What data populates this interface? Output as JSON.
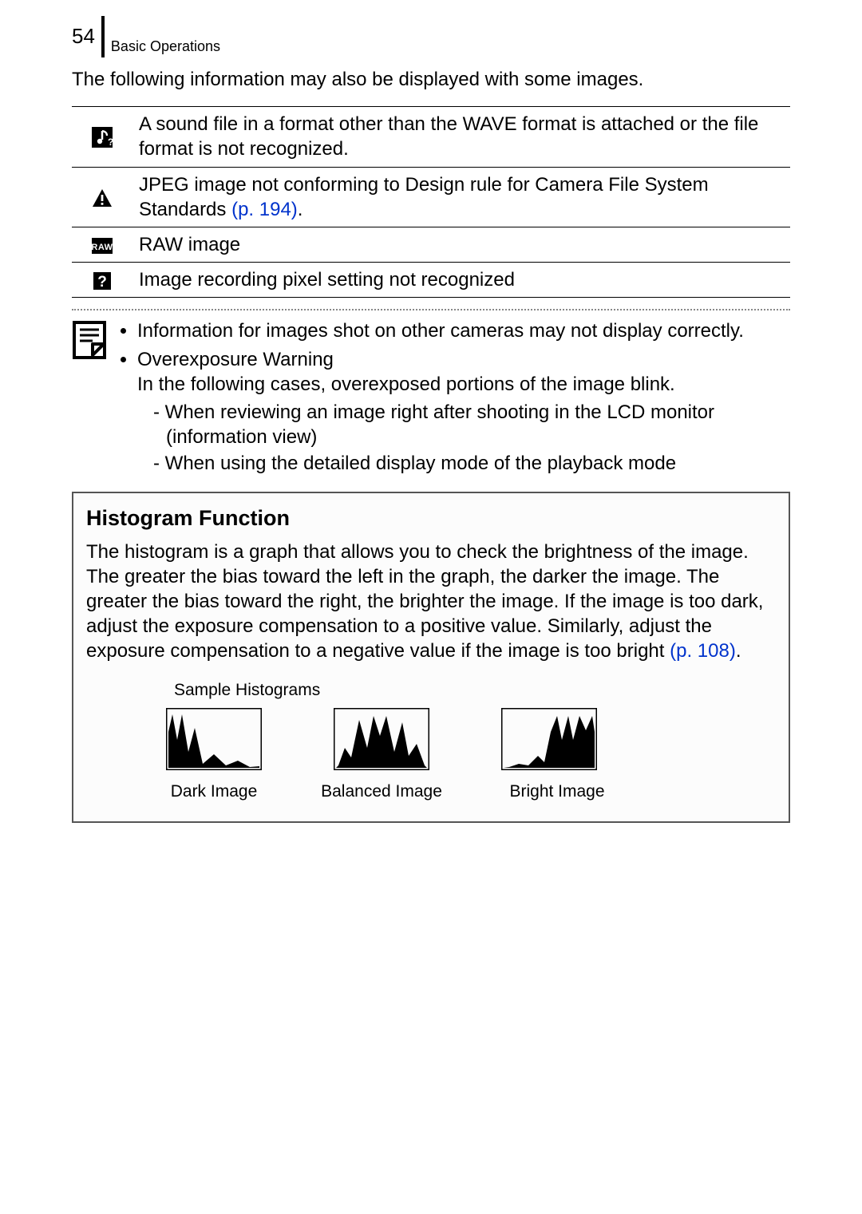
{
  "header": {
    "page_number": "54",
    "section": "Basic Operations"
  },
  "intro": "The following information may also be displayed with some images.",
  "table_rows": [
    {
      "icon": "music-question-icon",
      "desc": "A sound file in a format other than the WAVE format is attached or the file format is not recognized."
    },
    {
      "icon": "warning-triangle-icon",
      "desc": "JPEG image not conforming to Design rule for Camera File System Standards ",
      "page_ref": "(p. 194)",
      "desc_tail": "."
    },
    {
      "icon": "raw-icon",
      "desc": "RAW image"
    },
    {
      "icon": "question-box-icon",
      "desc": "Image recording pixel setting not recognized"
    }
  ],
  "note": {
    "bullet1": "Information for images shot on other cameras may not display correctly.",
    "bullet2_title": "Overexposure Warning",
    "bullet2_text": "In the following cases, overexposed portions of the image blink.",
    "dash1": "When reviewing an image right after shooting in the LCD monitor (information view)",
    "dash2": "When using the detailed display mode of the playback mode"
  },
  "histogram": {
    "heading": "Histogram Function",
    "text_a": "The histogram is a graph that allows you to check the brightness of the image. The greater the bias toward the left in the graph, the darker the image. The greater the bias toward the right, the brighter the image. If the image is too dark, adjust the exposure compensation to a positive value. Similarly, adjust the exposure compensation to a negative value if the image is too bright ",
    "page_ref": "(p. 108)",
    "text_b": ".",
    "samples_caption": "Sample Histograms",
    "labels": [
      "Dark Image",
      "Balanced Image",
      "Bright Image"
    ]
  }
}
